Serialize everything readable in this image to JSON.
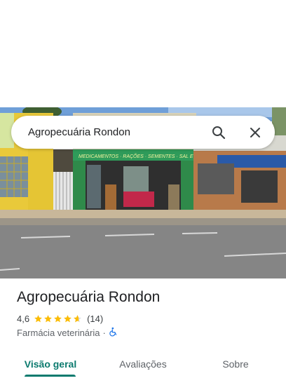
{
  "search": {
    "query": "Agropecuária Rondon",
    "search_icon": "search-icon",
    "close_icon": "close-icon"
  },
  "photo": {
    "storefront_banner": "MEDICAMENTOS · RAÇÕES · SEMENTES · SAL E VACINAS"
  },
  "place": {
    "name": "Agropecuária Rondon",
    "rating": "4,6",
    "stars": 4.6,
    "review_count": "(14)",
    "category": "Farmácia veterinária",
    "separator": "·",
    "accessibility_icon": "wheelchair-icon"
  },
  "tabs": [
    {
      "label": "Visão geral",
      "active": true
    },
    {
      "label": "Avaliações",
      "active": false
    },
    {
      "label": "Sobre",
      "active": false
    }
  ],
  "colors": {
    "accent": "#0b7a6e",
    "star": "#fbbc04",
    "accessibility": "#1a73e8"
  }
}
